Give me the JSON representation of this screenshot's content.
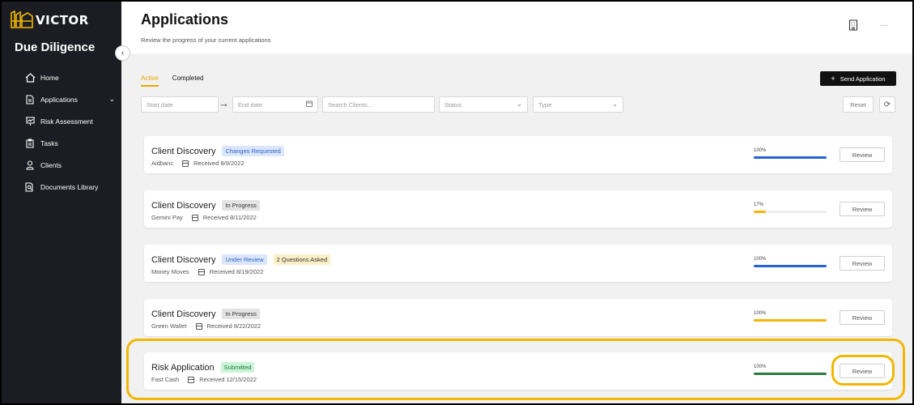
{
  "brand": {
    "name": "VICTOR",
    "app_name": "Due Diligence",
    "accent": "#f2b705"
  },
  "sidebar": {
    "items": [
      {
        "label": "Home",
        "icon": "home-icon"
      },
      {
        "label": "Applications",
        "icon": "document-icon",
        "expandable": true
      },
      {
        "label": "Risk Assessment",
        "icon": "presentation-chart-icon"
      },
      {
        "label": "Tasks",
        "icon": "clipboard-icon"
      },
      {
        "label": "Clients",
        "icon": "user-icon"
      },
      {
        "label": "Documents Library",
        "icon": "document-search-icon"
      }
    ]
  },
  "header": {
    "title": "Applications",
    "subtitle": "Review the progress of your current applications",
    "more": "..."
  },
  "tabs": [
    {
      "label": "Active",
      "active": true
    },
    {
      "label": "Completed",
      "active": false
    }
  ],
  "send_button": {
    "label": "Send Application",
    "icon": "plus-icon"
  },
  "filters": {
    "start_date": "Start date",
    "end_date": "End date",
    "search": "Search Clients...",
    "status": "Status",
    "type": "Type",
    "reset": "Reset"
  },
  "applications": [
    {
      "title": "Client Discovery",
      "badges": [
        {
          "text": "Changes Requested",
          "bg": "#dbe6fb",
          "fg": "#2f63c9"
        }
      ],
      "client": "Aidbanc",
      "received": "Received 8/9/2022",
      "progress_label": "100%",
      "progress": 1.0,
      "bar_color": "#2563d6",
      "review": "Review"
    },
    {
      "title": "Client Discovery",
      "badges": [
        {
          "text": "In Progress",
          "bg": "#e3e3e3",
          "fg": "#333333"
        }
      ],
      "client": "Gemini Pay",
      "received": "Received 8/11/2022",
      "progress_label": "17%",
      "progress": 0.17,
      "bar_color": "#f2b705",
      "review": "Review"
    },
    {
      "title": "Client Discovery",
      "badges": [
        {
          "text": "Under Review",
          "bg": "#dbe6fb",
          "fg": "#2f63c9"
        },
        {
          "text": "2 Questions Asked",
          "bg": "#fbefc6",
          "fg": "#333333"
        }
      ],
      "client": "Money Moves",
      "received": "Received 8/19/2022",
      "progress_label": "100%",
      "progress": 1.0,
      "bar_color": "#2563d6",
      "review": "Review"
    },
    {
      "title": "Client Discovery",
      "badges": [
        {
          "text": "In Progress",
          "bg": "#e3e3e3",
          "fg": "#333333"
        }
      ],
      "client": "Green Wallet",
      "received": "Received 8/22/2022",
      "progress_label": "100%",
      "progress": 1.0,
      "bar_color": "#f2b705",
      "review": "Review"
    },
    {
      "title": "Risk Application",
      "badges": [
        {
          "text": "Submitted",
          "bg": "#c9f5d6",
          "fg": "#1e7a3c"
        }
      ],
      "client": "Fast Cash",
      "received": "Received 12/15/2022",
      "progress_label": "100%",
      "progress": 1.0,
      "bar_color": "#2a7a3e",
      "review": "Review"
    }
  ]
}
